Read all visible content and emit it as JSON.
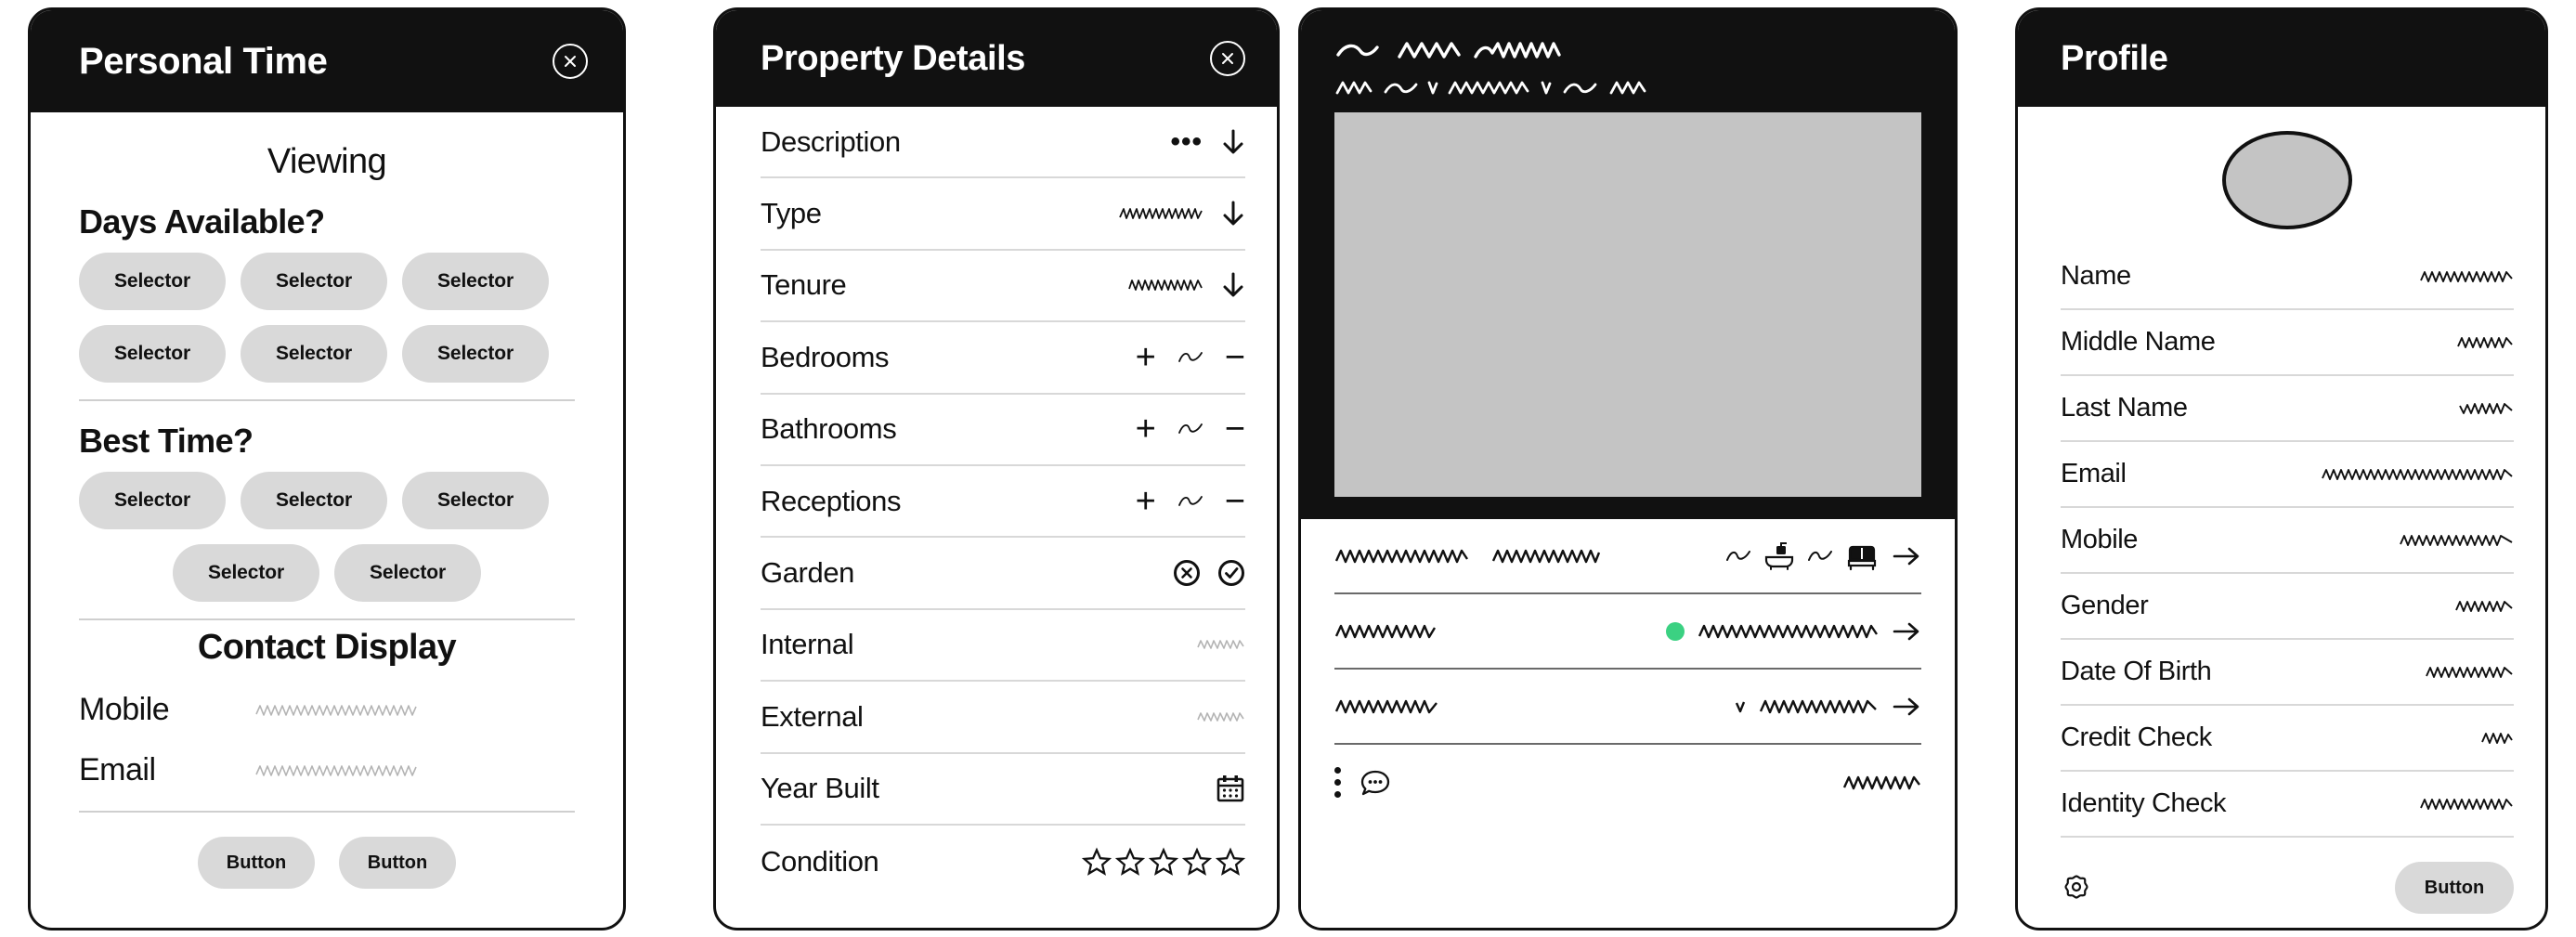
{
  "panels": {
    "personal_time": {
      "title": "Personal Time",
      "close_icon": "close-circle-icon",
      "section_viewing": "Viewing",
      "section_days": "Days Available?",
      "section_best_time": "Best Time?",
      "section_contact": "Contact Display",
      "days_selectors": [
        "Selector",
        "Selector",
        "Selector",
        "Selector",
        "Selector",
        "Selector"
      ],
      "best_time_selectors_row1": [
        "Selector",
        "Selector",
        "Selector"
      ],
      "best_time_selectors_row2": [
        "Selector",
        "Selector"
      ],
      "contact_rows": [
        {
          "label": "Mobile",
          "value": "scribble-placeholder"
        },
        {
          "label": "Email",
          "value": "scribble-placeholder"
        }
      ],
      "buttons": [
        "Button",
        "Button"
      ]
    },
    "property_details": {
      "title": "Property Details",
      "close_icon": "close-circle-icon",
      "rows": [
        {
          "label": "Description",
          "control": "ellipsis-chevron",
          "ellipsis": "•••",
          "icon": "arrow-down-icon"
        },
        {
          "label": "Type",
          "control": "scribble-chevron",
          "icon": "arrow-down-icon"
        },
        {
          "label": "Tenure",
          "control": "scribble-chevron",
          "icon": "arrow-down-icon"
        },
        {
          "label": "Bedrooms",
          "control": "stepper",
          "plus": "+",
          "minus": "−"
        },
        {
          "label": "Bathrooms",
          "control": "stepper",
          "plus": "+",
          "minus": "−"
        },
        {
          "label": "Receptions",
          "control": "stepper",
          "plus": "+",
          "minus": "−"
        },
        {
          "label": "Garden",
          "control": "yes-no",
          "no_icon": "cross-circle-icon",
          "yes_icon": "check-circle-icon"
        },
        {
          "label": "Internal",
          "control": "scribble"
        },
        {
          "label": "External",
          "control": "scribble"
        },
        {
          "label": "Year Built",
          "control": "calendar",
          "icon": "calendar-icon"
        },
        {
          "label": "Condition",
          "control": "rating",
          "stars": 5,
          "filled": 0
        }
      ]
    },
    "listing": {
      "header_scribbles": [
        "scribble-title",
        "scribble-subtitle"
      ],
      "image_placeholder": "image-placeholder",
      "rows": [
        {
          "left": "scribble-long",
          "left_2": "scribble-medium",
          "amenities": [
            {
              "count": "scribble-num",
              "icon": "bathtub-icon"
            },
            {
              "count": "scribble-num",
              "icon": "bed-icon"
            }
          ],
          "action_icon": "arrow-right-icon"
        },
        {
          "left": "scribble-medium",
          "status_dot": "status-dot",
          "right": "scribble-long",
          "action_icon": "arrow-right-icon"
        },
        {
          "left": "scribble-medium",
          "right": "scribble-long",
          "action_icon": "arrow-right-icon"
        },
        {
          "menu_icon": "kebab-menu-icon",
          "chat_icon": "chat-bubble-icon",
          "right": "scribble-short"
        }
      ]
    },
    "profile": {
      "title": "Profile",
      "avatar": "avatar-placeholder",
      "rows": [
        {
          "label": "Name",
          "value": "scribble-medium"
        },
        {
          "label": "Middle Name",
          "value": "scribble-short"
        },
        {
          "label": "Last Name",
          "value": "scribble-short"
        },
        {
          "label": "Email",
          "value": "scribble-extralong"
        },
        {
          "label": "Mobile",
          "value": "scribble-long"
        },
        {
          "label": "Gender",
          "value": "scribble-short"
        },
        {
          "label": "Date Of Birth",
          "value": "scribble-medium"
        },
        {
          "label": "Credit Check",
          "value": "scribble-tiny"
        },
        {
          "label": "Identity Check",
          "value": "scribble-medium"
        }
      ],
      "settings_icon": "gear-icon",
      "button": "Button"
    }
  },
  "colors": {
    "header_bg": "#111111",
    "card_border": "#111111",
    "pill_bg": "#d9d9d9",
    "image_placeholder": "#c4c4c4",
    "divider": "#d8d8d8",
    "status_green": "#3BD182",
    "text": "#111111",
    "scribble_light": "#b4b4b4",
    "scribble_dark": "#111111"
  }
}
